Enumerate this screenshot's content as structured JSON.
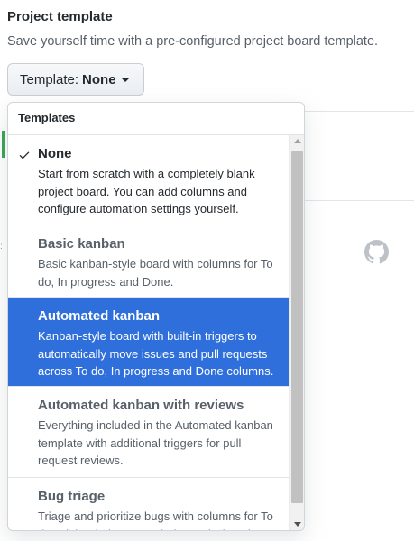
{
  "section": {
    "title": "Project template",
    "description": "Save yourself time with a pre-configured project board template."
  },
  "template_button": {
    "prefix": "Template:",
    "selected": "None"
  },
  "menu": {
    "header": "Templates",
    "items": [
      {
        "title": "None",
        "description": "Start from scratch with a completely blank project board. You can add columns and configure automation settings yourself.",
        "checked": true
      },
      {
        "title": "Basic kanban",
        "description": "Basic kanban-style board with columns for To do, In progress and Done."
      },
      {
        "title": "Automated kanban",
        "description": "Kanban-style board with built-in triggers to automatically move issues and pull requests across To do, In progress and Done columns.",
        "highlighted": true
      },
      {
        "title": "Automated kanban with reviews",
        "description": "Everything included in the Automated kanban template with additional triggers for pull request reviews."
      },
      {
        "title": "Bug triage",
        "description": "Triage and prioritize bugs with columns for To do, High priority, Low priority, and Closed."
      }
    ]
  },
  "colors": {
    "highlight": "#2f6fdc",
    "text": "#24292e",
    "muted": "#586069"
  },
  "icons": [
    "check-icon",
    "caret-down-icon",
    "github-logo-icon",
    "scroll-up-icon",
    "scroll-down-icon"
  ]
}
